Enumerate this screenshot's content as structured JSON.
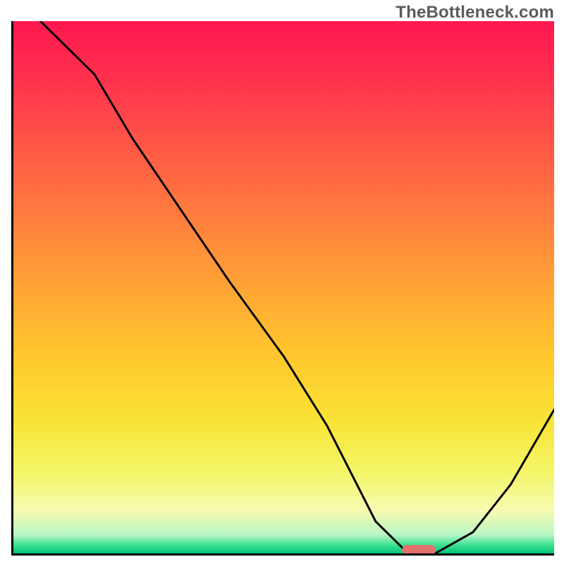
{
  "watermark": "TheBottleneck.com",
  "chart_data": {
    "type": "line",
    "title": "",
    "xlabel": "",
    "ylabel": "",
    "xlim": [
      0,
      100
    ],
    "ylim": [
      0,
      100
    ],
    "grid": false,
    "background_gradient": {
      "direction": "top-to-bottom",
      "stops": [
        {
          "pos": 0,
          "color": "#ff1750"
        },
        {
          "pos": 0.5,
          "color": "#ffa435"
        },
        {
          "pos": 0.85,
          "color": "#f4f66a"
        },
        {
          "pos": 1.0,
          "color": "#03c179"
        }
      ]
    },
    "series": [
      {
        "name": "bottleneck-curve",
        "x": [
          5,
          15,
          22,
          30,
          40,
          50,
          58,
          63,
          67,
          72,
          78,
          85,
          92,
          100
        ],
        "y": [
          100,
          90,
          78,
          66,
          51,
          37,
          24,
          14,
          6,
          1,
          0,
          4,
          13,
          27
        ]
      }
    ],
    "marker": {
      "name": "optimal-marker",
      "x": 75,
      "y": 0,
      "color": "#e2716e",
      "shape": "pill"
    },
    "legend": false
  }
}
